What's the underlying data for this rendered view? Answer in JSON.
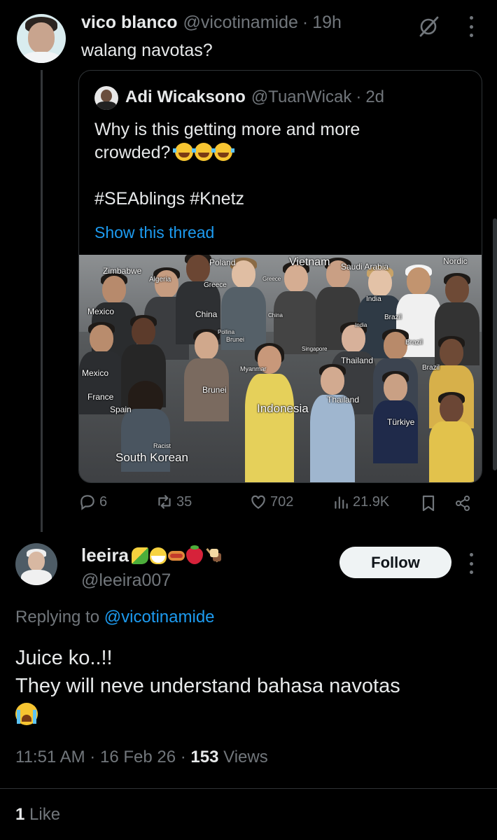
{
  "tweet1": {
    "author_name": "vico blanco",
    "author_handle": "@vicotinamide",
    "separator": "·",
    "time": "19h",
    "text": "walang navotas?",
    "quote": {
      "author_name": "Adi Wicaksono",
      "author_handle": "@TuanWicak",
      "time": "2d",
      "line1": "Why is this getting more and more",
      "line2": "crowded?",
      "hashtags": "#SEAblings #Knetz",
      "show_thread": "Show this thread",
      "image_labels": {
        "zimbabwe": "Zimbabwe",
        "algeria": "Algeria",
        "poland": "Poland",
        "greece": "Greece",
        "greece2": "Greece",
        "vietnam": "Vietnam",
        "saudi": "Saudi Arabia",
        "nordic": "Nordic",
        "india": "India",
        "india2": "India",
        "mexico": "Mexico",
        "mexico2": "Mexico",
        "china": "China",
        "china2": "China",
        "brazil": "Brazil",
        "brazil2": "Brazil",
        "brazil3": "Brazil",
        "pollina": "Pollina",
        "brunei": "Brunei",
        "brunei2": "Brunei",
        "singapore": "Singapore",
        "thailand": "Thailand",
        "thailand2": "Thailand",
        "myanmar": "Myanmar",
        "france": "France",
        "spain": "Spain",
        "indonesia": "Indonesia",
        "turkiye": "Türkiye",
        "racist": "Racist",
        "south_korean": "South Korean"
      }
    },
    "actions": {
      "replies": "6",
      "reposts": "35",
      "likes": "702",
      "views": "21.9K"
    }
  },
  "tweet2": {
    "author_name": "leeira",
    "author_handle": "@leeira007",
    "follow_label": "Follow",
    "replying_prefix": "Replying to",
    "replying_mention": "@vicotinamide",
    "body_line1": "Juice ko..!!",
    "body_line2": "They will neve understand bahasa navotas",
    "time": "11:51 AM",
    "date": "16 Feb 26",
    "separator": "·",
    "views_count": "153",
    "views_label": "Views",
    "likes_count": "1",
    "likes_label": "Like"
  },
  "colors": {
    "background": "#000000",
    "text": "#e7e9ea",
    "muted": "#71767b",
    "link": "#1d9bf0",
    "border": "#2f3336"
  },
  "icons": [
    "grok-icon",
    "more-icon",
    "reply-icon",
    "repost-icon",
    "like-icon",
    "views-icon",
    "bookmark-icon",
    "share-icon",
    "crying-emoji",
    "laughing-emoji"
  ]
}
